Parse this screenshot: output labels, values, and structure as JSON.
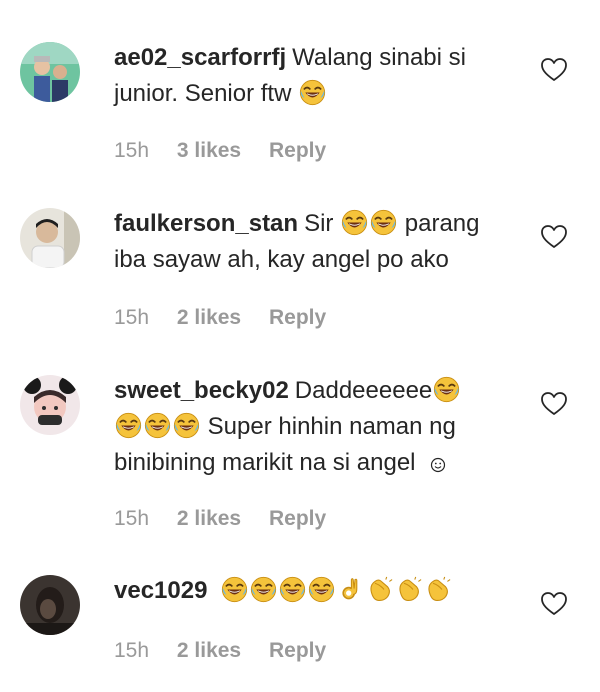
{
  "comments": [
    {
      "username": "ae02_scarforrfj",
      "text_1": "Walang sinabi si",
      "text_2": "junior. Senior ftw",
      "time": "15h",
      "likes": "3 likes",
      "reply": "Reply"
    },
    {
      "username": "faulkerson_stan",
      "text_1": "Sir",
      "text_1b": "parang",
      "text_2": "iba sayaw ah, kay angel po ako",
      "time": "15h",
      "likes": "2 likes",
      "reply": "Reply"
    },
    {
      "username": "sweet_becky02",
      "text_1": "Daddeeeeee",
      "text_2": "Super hinhin naman ng",
      "text_3": "binibining marikit na si angel",
      "time": "15h",
      "likes": "2 likes",
      "reply": "Reply"
    },
    {
      "username": "vec1029",
      "time": "15h",
      "likes": "2 likes",
      "reply": "Reply"
    }
  ],
  "icons": {
    "laugh": "face-with-tears-of-joy-icon",
    "ok": "ok-hand-icon",
    "clap": "clapping-hands-icon",
    "heart": "heart-outline-icon",
    "smile": "smiling-face-icon"
  },
  "colors": {
    "text": "#262626",
    "meta": "#999999",
    "emoji_yellow": "#f5c33b"
  }
}
